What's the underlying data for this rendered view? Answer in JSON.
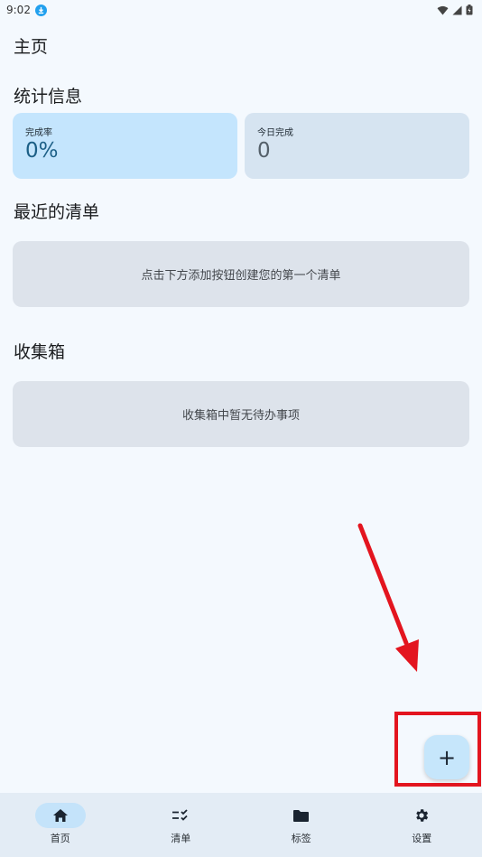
{
  "status_bar": {
    "time": "9:02"
  },
  "page": {
    "title": "主页"
  },
  "stats": {
    "title": "统计信息",
    "completion_rate": {
      "label": "完成率",
      "value": "0%"
    },
    "today_completed": {
      "label": "今日完成",
      "value": "0"
    }
  },
  "recent_lists": {
    "title": "最近的清单",
    "empty_text": "点击下方添加按钮创建您的第一个清单"
  },
  "inbox": {
    "title": "收集箱",
    "empty_text": "收集箱中暂无待办事项"
  },
  "fab": {
    "label": "+"
  },
  "annotation": {
    "color": "#e3151f"
  },
  "nav": {
    "items": [
      {
        "label": "首页",
        "icon": "home-icon",
        "active": true
      },
      {
        "label": "清单",
        "icon": "checklist-icon",
        "active": false
      },
      {
        "label": "标签",
        "icon": "folder-icon",
        "active": false
      },
      {
        "label": "设置",
        "icon": "gear-icon",
        "active": false
      }
    ]
  },
  "colors": {
    "background": "#f4f9fe",
    "accent_card": "#c4e5fd",
    "nav_active_pill": "#c4e3fa"
  }
}
